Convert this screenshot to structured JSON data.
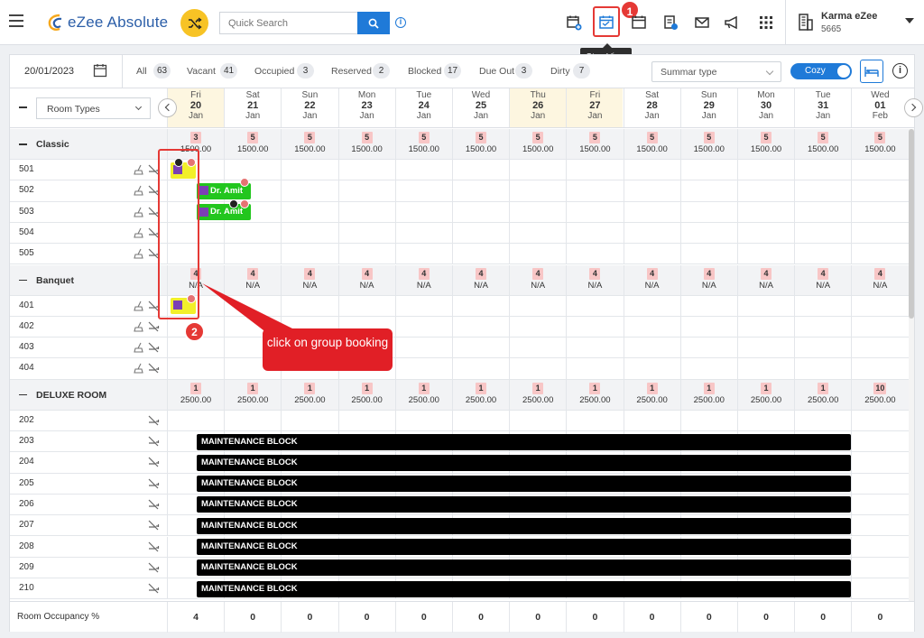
{
  "app": {
    "name": "eZee Absolute"
  },
  "topbar": {
    "search_placeholder": "Quick Search",
    "tooltip": "Stay View",
    "step1": "1",
    "hotel_name": "Karma eZee",
    "hotel_id": "5665"
  },
  "filters": {
    "date": "20/01/2023",
    "items": [
      {
        "label": "All",
        "count": "63"
      },
      {
        "label": "Vacant",
        "count": "41"
      },
      {
        "label": "Occupied",
        "count": "3"
      },
      {
        "label": "Reserved",
        "count": "2"
      },
      {
        "label": "Blocked",
        "count": "17"
      },
      {
        "label": "Due Out",
        "count": "3"
      },
      {
        "label": "Dirty",
        "count": "7"
      }
    ],
    "summary_select": "Summar type",
    "view_toggle": "Cozy"
  },
  "grid": {
    "room_types_select": "Room Types",
    "dates": [
      {
        "dow": "Fri",
        "day": "20",
        "mon": "Jan",
        "we": true
      },
      {
        "dow": "Sat",
        "day": "21",
        "mon": "Jan",
        "we": false
      },
      {
        "dow": "Sun",
        "day": "22",
        "mon": "Jan",
        "we": false
      },
      {
        "dow": "Mon",
        "day": "23",
        "mon": "Jan",
        "we": false
      },
      {
        "dow": "Tue",
        "day": "24",
        "mon": "Jan",
        "we": false
      },
      {
        "dow": "Wed",
        "day": "25",
        "mon": "Jan",
        "we": false
      },
      {
        "dow": "Thu",
        "day": "26",
        "mon": "Jan",
        "we": true
      },
      {
        "dow": "Fri",
        "day": "27",
        "mon": "Jan",
        "we": true
      },
      {
        "dow": "Sat",
        "day": "28",
        "mon": "Jan",
        "we": false
      },
      {
        "dow": "Sun",
        "day": "29",
        "mon": "Jan",
        "we": false
      },
      {
        "dow": "Mon",
        "day": "30",
        "mon": "Jan",
        "we": false
      },
      {
        "dow": "Tue",
        "day": "31",
        "mon": "Jan",
        "we": false
      },
      {
        "dow": "Wed",
        "day": "01",
        "mon": "Feb",
        "we": false
      }
    ],
    "groups": [
      {
        "name": "Classic",
        "avail": [
          "3",
          "5",
          "5",
          "5",
          "5",
          "5",
          "5",
          "5",
          "5",
          "5",
          "5",
          "5",
          "5"
        ],
        "rate": [
          "1500.00",
          "1500.00",
          "1500.00",
          "1500.00",
          "1500.00",
          "1500.00",
          "1500.00",
          "1500.00",
          "1500.00",
          "1500.00",
          "1500.00",
          "1500.00",
          "1500.00"
        ],
        "rooms": [
          "501",
          "502",
          "503",
          "504",
          "505"
        ]
      },
      {
        "name": "Banquet",
        "avail": [
          "4",
          "4",
          "4",
          "4",
          "4",
          "4",
          "4",
          "4",
          "4",
          "4",
          "4",
          "4",
          "4"
        ],
        "rate": [
          "N/A",
          "N/A",
          "N/A",
          "N/A",
          "N/A",
          "N/A",
          "N/A",
          "N/A",
          "N/A",
          "N/A",
          "N/A",
          "N/A",
          "N/A"
        ],
        "rooms": [
          "401",
          "402",
          "403",
          "404"
        ]
      },
      {
        "name": "DELUXE ROOM",
        "avail": [
          "1",
          "1",
          "1",
          "1",
          "1",
          "1",
          "1",
          "1",
          "1",
          "1",
          "1",
          "1",
          "10"
        ],
        "rate": [
          "2500.00",
          "2500.00",
          "2500.00",
          "2500.00",
          "2500.00",
          "2500.00",
          "2500.00",
          "2500.00",
          "2500.00",
          "2500.00",
          "2500.00",
          "2500.00",
          "2500.00"
        ],
        "rooms": [
          "202",
          "203",
          "204",
          "205",
          "206",
          "207",
          "208",
          "209",
          "210"
        ]
      }
    ],
    "bookings": [
      {
        "room": "502",
        "guest": "Dr. Amit"
      },
      {
        "room": "503",
        "guest": "Dr. Amit"
      }
    ],
    "block_label": "MAINTENANCE BLOCK",
    "occupancy_label": "Room Occupancy %",
    "occupancy": [
      "4",
      "0",
      "0",
      "0",
      "0",
      "0",
      "0",
      "0",
      "0",
      "0",
      "0",
      "0",
      "0"
    ]
  },
  "annotation": {
    "step2": "2",
    "callout": "click on group booking"
  },
  "colors": {
    "brand_blue": "#1f7ad8",
    "booking_green": "#22c61e",
    "group_yellow": "#f2ef2a",
    "annotation_red": "#e11f26"
  }
}
